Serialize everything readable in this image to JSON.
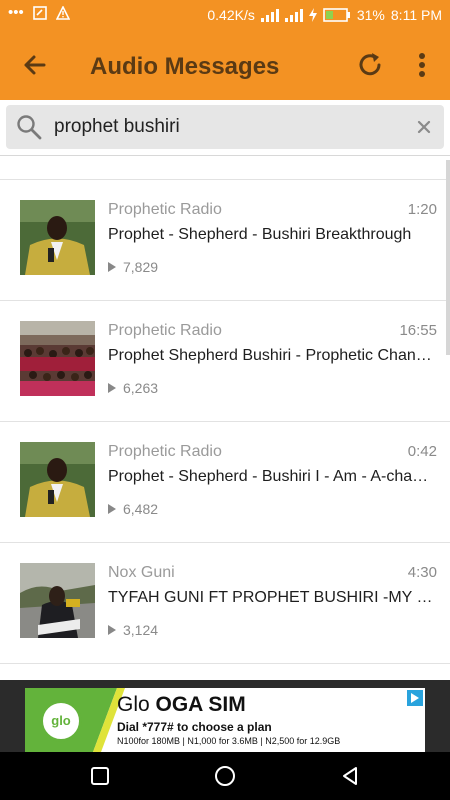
{
  "status_bar": {
    "speed": "0.42K/s",
    "battery": "31%",
    "time": "8:11 PM"
  },
  "app_bar": {
    "title": "Audio Messages"
  },
  "search": {
    "value": "prophet bushiri",
    "placeholder": ""
  },
  "results": [
    {
      "channel": "Prophetic Radio",
      "duration": "1:20",
      "title": "Prophet - Shepherd - Bushiri Breakthrough",
      "plays": "7,829",
      "thumb": "man-in-suit"
    },
    {
      "channel": "Prophetic Radio",
      "duration": "16:55",
      "title": "Prophet Shepherd Bushiri - Prophetic Channel",
      "plays": "6,263",
      "thumb": "crowd"
    },
    {
      "channel": "Prophetic Radio",
      "duration": "0:42",
      "title": "Prophet - Shepherd - Bushiri I - Am - A-champion",
      "plays": "6,482",
      "thumb": "man-in-suit"
    },
    {
      "channel": "Nox Guni",
      "duration": "4:30",
      "title": "TYFAH GUNI FT PROPHET BUSHIRI -MY FAVOUR",
      "plays": "3,124",
      "thumb": "performer"
    }
  ],
  "ad": {
    "logo_text": "glo",
    "headline_prefix": "Glo ",
    "headline_bold": "OGA SIM",
    "line2": "Dial *777# to choose a plan",
    "line3": "N100for 180MB | N1,000 for 3.6MB | N2,500 for 12.9GB"
  },
  "colors": {
    "accent": "#f39223",
    "title_text": "#5a3a14",
    "glo_green": "#63b33b"
  }
}
